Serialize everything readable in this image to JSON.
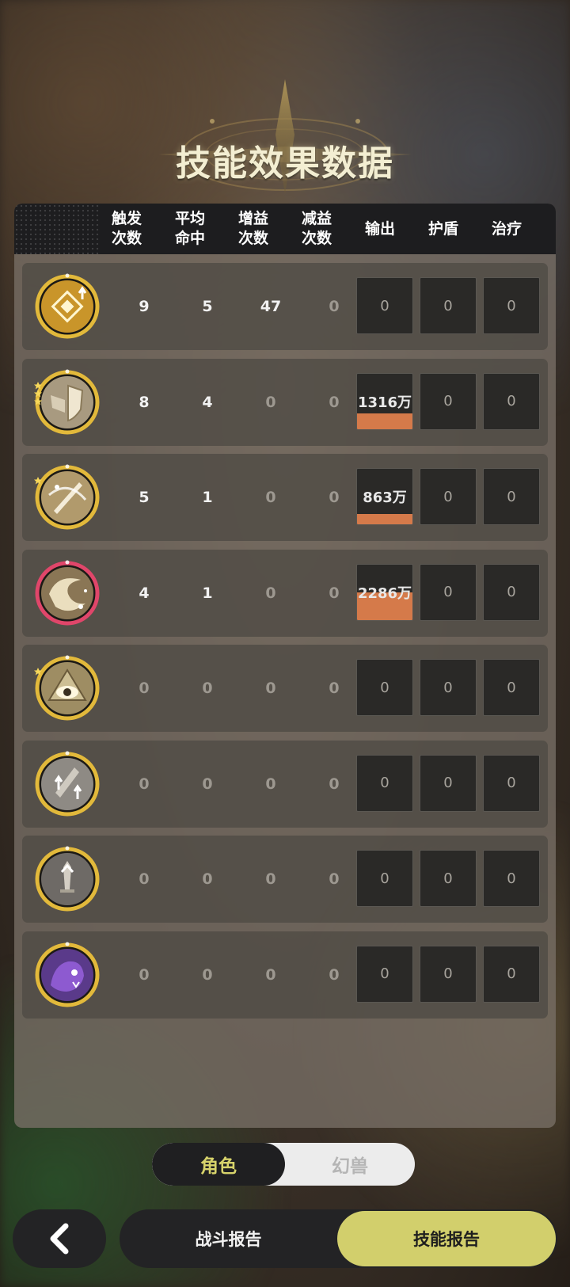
{
  "title": "技能效果数据",
  "headers": [
    "触发\n次数",
    "平均\n命中",
    "增益\n次数",
    "减益\n次数",
    "输出",
    "护盾",
    "治疗"
  ],
  "rows": [
    {
      "icon": "golden-crest-up-icon",
      "ring": "#e2b93b",
      "trigger": "9",
      "hits": "5",
      "buff": "47",
      "debuff": "0",
      "output": "0",
      "output_fill": 0,
      "shield": "0",
      "heal": "0"
    },
    {
      "icon": "shield-horn-icon",
      "ring": "#e2b93b",
      "trigger": "8",
      "hits": "4",
      "buff": "0",
      "debuff": "0",
      "output": "1316万",
      "output_fill": 0.28,
      "shield": "0",
      "heal": "0"
    },
    {
      "icon": "sword-slash-icon",
      "ring": "#e2b93b",
      "trigger": "5",
      "hits": "1",
      "buff": "0",
      "debuff": "0",
      "output": "863万",
      "output_fill": 0.18,
      "shield": "0",
      "heal": "0"
    },
    {
      "icon": "swirl-sparkle-icon",
      "ring": "#e0466a",
      "trigger": "4",
      "hits": "1",
      "buff": "0",
      "debuff": "0",
      "output": "2286万",
      "output_fill": 0.5,
      "shield": "0",
      "heal": "0"
    },
    {
      "icon": "eye-emblem-icon",
      "ring": "#e2b93b",
      "trigger": "0",
      "hits": "0",
      "buff": "0",
      "debuff": "0",
      "output": "0",
      "output_fill": 0,
      "shield": "0",
      "heal": "0"
    },
    {
      "icon": "sword-up-arrows-icon",
      "ring": "#e2b93b",
      "trigger": "0",
      "hits": "0",
      "buff": "0",
      "debuff": "0",
      "output": "0",
      "output_fill": 0,
      "shield": "0",
      "heal": "0"
    },
    {
      "icon": "dagger-up-icon",
      "ring": "#e2b93b",
      "trigger": "0",
      "hits": "0",
      "buff": "0",
      "debuff": "0",
      "output": "0",
      "output_fill": 0,
      "shield": "0",
      "heal": "0"
    },
    {
      "icon": "purple-beast-icon",
      "ring": "#e2b93b",
      "trigger": "0",
      "hits": "0",
      "buff": "0",
      "debuff": "0",
      "output": "0",
      "output_fill": 0,
      "shield": "0",
      "heal": "0"
    }
  ],
  "toggle": {
    "active": "角色",
    "inactive": "幻兽"
  },
  "back_icon": "chevron-left-icon",
  "tabs": {
    "battle": "战斗报告",
    "skill": "技能报告"
  },
  "colors": {
    "accent": "#d2cf6c",
    "output_bar": "#d57a4a",
    "toggle_text": "#d7d36b"
  }
}
